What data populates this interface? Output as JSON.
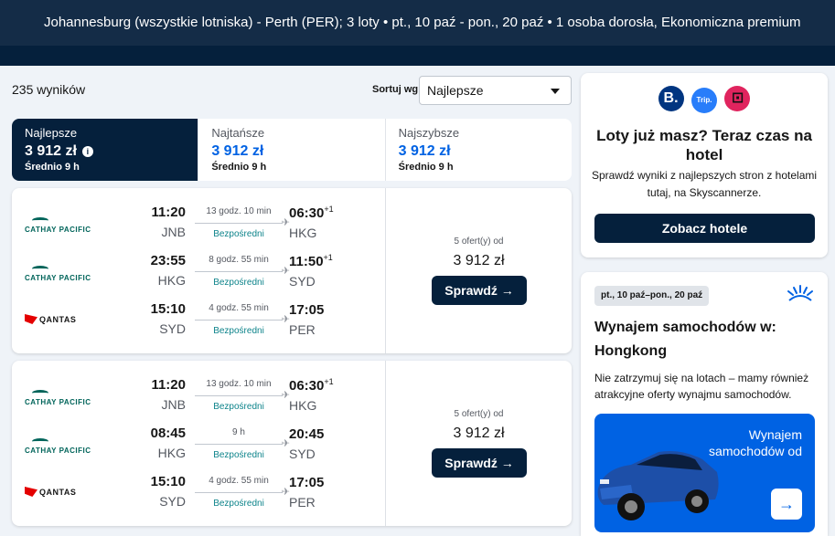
{
  "header": {
    "summary": "Johannesburg (wszystkie lotniska) - Perth (PER); 3 loty  •  pt., 10 paź - pon., 20 paź  •  1 osoba dorosła, Ekonomiczna premium"
  },
  "results": {
    "count_label": "235 wyników",
    "sort_label": "Sortuj wg",
    "sort_value": "Najlepsze"
  },
  "tabs": [
    {
      "name": "Najlepsze",
      "price": "3 912 zł",
      "avg": "Średnio 9 h",
      "active": true
    },
    {
      "name": "Najtańsze",
      "price": "3 912 zł",
      "avg": "Średnio 9 h",
      "active": false
    },
    {
      "name": "Najszybsze",
      "price": "3 912 zł",
      "avg": "Średnio 9 h",
      "active": false
    }
  ],
  "cards": [
    {
      "legs": [
        {
          "airline": "CATHAY PACIFIC",
          "dep_time": "11:20",
          "dep_code": "JNB",
          "duration": "13 godz. 10 min",
          "stops": "Bezpośredni",
          "arr_time": "06:30",
          "arr_plus": "+1",
          "arr_code": "HKG"
        },
        {
          "airline": "CATHAY PACIFIC",
          "dep_time": "23:55",
          "dep_code": "HKG",
          "duration": "8 godz. 55 min",
          "stops": "Bezpośredni",
          "arr_time": "11:50",
          "arr_plus": "+1",
          "arr_code": "SYD"
        },
        {
          "airline": "QANTAS",
          "dep_time": "15:10",
          "dep_code": "SYD",
          "duration": "4 godz. 55 min",
          "stops": "Bezpośredni",
          "arr_time": "17:05",
          "arr_plus": "",
          "arr_code": "PER"
        }
      ],
      "offers": "5 ofert(y) od",
      "price": "3 912 zł",
      "button": "Sprawdź →"
    },
    {
      "legs": [
        {
          "airline": "CATHAY PACIFIC",
          "dep_time": "11:20",
          "dep_code": "JNB",
          "duration": "13 godz. 10 min",
          "stops": "Bezpośredni",
          "arr_time": "06:30",
          "arr_plus": "+1",
          "arr_code": "HKG"
        },
        {
          "airline": "CATHAY PACIFIC",
          "dep_time": "08:45",
          "dep_code": "HKG",
          "duration": "9 h",
          "stops": "Bezpośredni",
          "arr_time": "20:45",
          "arr_plus": "",
          "arr_code": "SYD"
        },
        {
          "airline": "QANTAS",
          "dep_time": "15:10",
          "dep_code": "SYD",
          "duration": "4 godz. 55 min",
          "stops": "Bezpośredni",
          "arr_time": "17:05",
          "arr_plus": "",
          "arr_code": "PER"
        }
      ],
      "offers": "5 ofert(y) od",
      "price": "3 912 zł",
      "button": "Sprawdź →"
    }
  ],
  "hotel_ad": {
    "logos": [
      "B.",
      "Trip.",
      ""
    ],
    "title": "Loty już masz? Teraz czas na hotel",
    "text": "Sprawdź wyniki z najlepszych stron z hotelami tutaj, na Skyscannerze.",
    "button": "Zobacz hotele"
  },
  "car_ad": {
    "dates": "pt., 10 paź–pon., 20 paź",
    "title": "Wynajem samochodów w: Hongkong",
    "text": "Nie zatrzymuj się na lotach – mamy również atrakcyjne oferty wynajmu samochodów.",
    "promo": "Wynajem samochodów od",
    "arrow": "→"
  },
  "colors": {
    "navy": "#05203c",
    "blue": "#0062e3",
    "teal": "#0c838a"
  }
}
